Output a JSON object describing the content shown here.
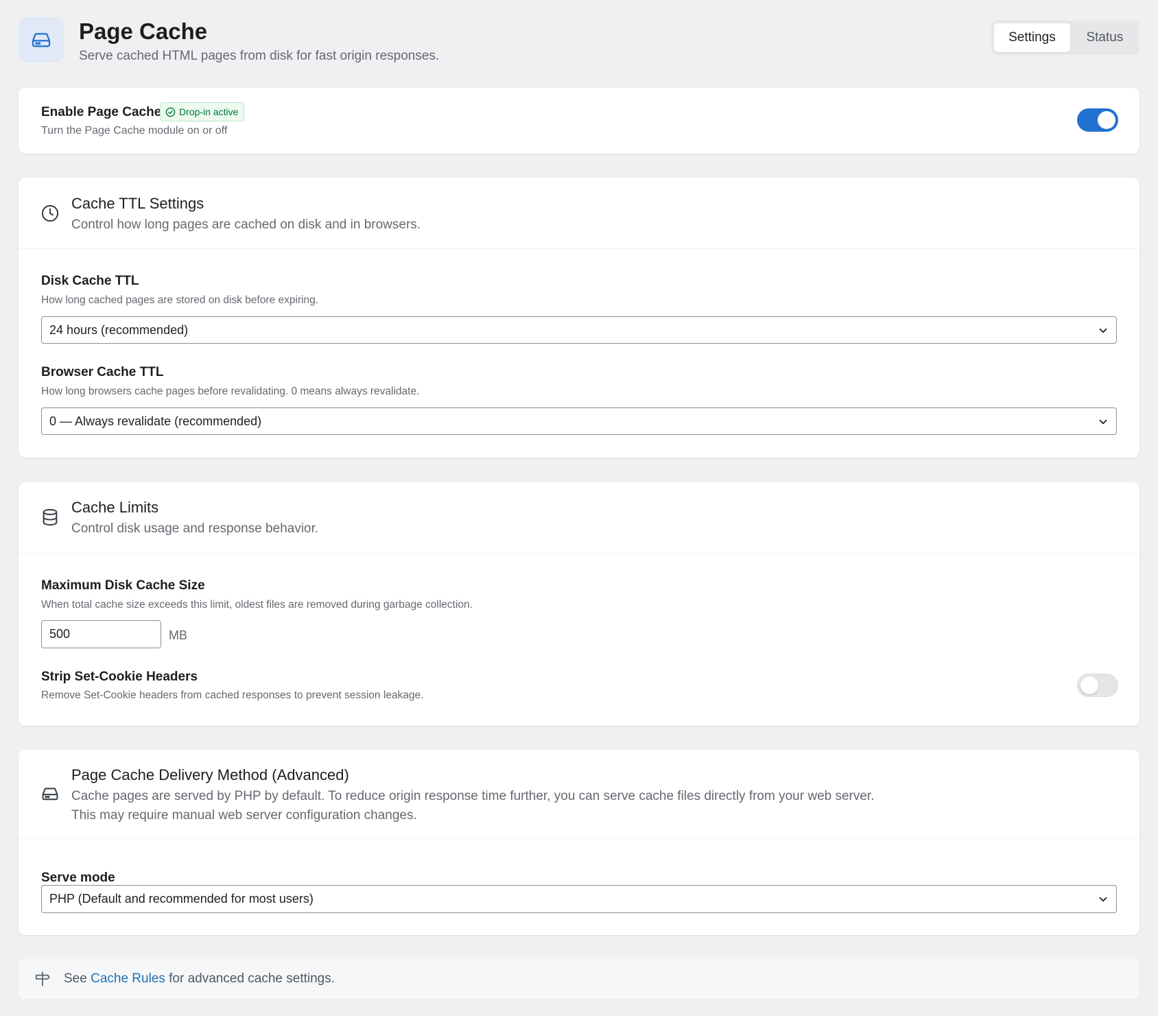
{
  "header": {
    "title": "Page Cache",
    "subtitle": "Serve cached HTML pages from disk for fast origin responses.",
    "icon": "hard-drive-icon",
    "tabs": [
      {
        "label": "Settings",
        "active": true
      },
      {
        "label": "Status",
        "active": false
      }
    ]
  },
  "enable_card": {
    "label": "Enable Page Cache",
    "badge": "Drop-in active",
    "badge_icon": "check-circle-icon",
    "description": "Turn the Page Cache module on or off",
    "enabled": true
  },
  "ttl_card": {
    "icon": "clock-icon",
    "title": "Cache TTL Settings",
    "description": "Control how long pages are cached on disk and in browsers.",
    "disk_label": "Disk Cache TTL",
    "disk_hint": "How long cached pages are stored on disk before expiring.",
    "disk_value": "24 hours (recommended)",
    "browser_label": "Browser Cache TTL",
    "browser_hint": "How long browsers cache pages before revalidating. 0 means always revalidate.",
    "browser_value": "0 — Always revalidate (recommended)"
  },
  "limits_card": {
    "icon": "database-icon",
    "title": "Cache Limits",
    "description": "Control disk usage and response behavior.",
    "max_label": "Maximum Disk Cache Size",
    "max_hint": "When total cache size exceeds this limit, oldest files are removed during garbage collection.",
    "max_value": "500",
    "max_unit": "MB",
    "strip_label": "Strip Set-Cookie Headers",
    "strip_hint": "Remove Set-Cookie headers from cached responses to prevent session leakage.",
    "strip_enabled": false
  },
  "delivery_card": {
    "icon": "hard-drive-icon",
    "title": "Page Cache Delivery Method (Advanced)",
    "description_line1": "Cache pages are served by PHP by default. To reduce origin response time further, you can serve cache files directly from your web server.",
    "description_line2": "This may require manual web server configuration changes.",
    "serve_label": "Serve mode",
    "serve_value": "PHP (Default and recommended for most users)"
  },
  "footer": {
    "icon": "signpost-icon",
    "prefix": "See",
    "link": "Cache Rules",
    "suffix": "for advanced cache settings."
  },
  "colors": {
    "accent": "#2271d1",
    "link": "#2271b1",
    "badge_green": "#00793a",
    "background": "#f0f0f3"
  }
}
